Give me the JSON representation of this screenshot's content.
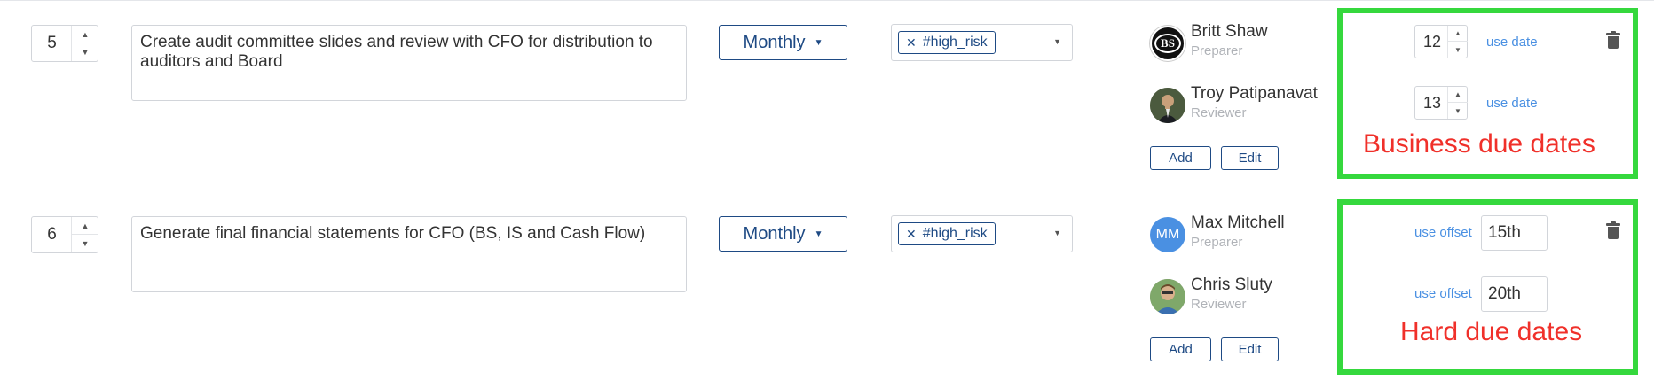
{
  "rows": [
    {
      "order": "5",
      "description": "Create audit committee slides and review with CFO for distribution to auditors and Board",
      "frequency": "Monthly",
      "tag": "#high_risk",
      "preparer": {
        "initials": "BS",
        "name": "Britt Shaw",
        "role": "Preparer"
      },
      "reviewer": {
        "name": "Troy Patipanavat",
        "role": "Reviewer"
      },
      "add_label": "Add",
      "edit_label": "Edit",
      "due": {
        "preparer_day": "12",
        "reviewer_day": "13",
        "link_label": "use date",
        "annotation": "Business due dates"
      }
    },
    {
      "order": "6",
      "description": "Generate final financial statements for CFO (BS, IS and Cash Flow)",
      "frequency": "Monthly",
      "tag": "#high_risk",
      "preparer": {
        "initials": "MM",
        "name": "Max Mitchell",
        "role": "Preparer"
      },
      "reviewer": {
        "name": "Chris Sluty",
        "role": "Reviewer"
      },
      "add_label": "Add",
      "edit_label": "Edit",
      "due": {
        "preparer_day": "15th",
        "reviewer_day": "20th",
        "link_label": "use offset",
        "annotation": "Hard due dates"
      }
    }
  ],
  "icons": {
    "spin_up": "▲",
    "spin_down": "▼",
    "caret": "▼",
    "remove": "✕"
  },
  "colors": {
    "highlight_border": "#35d83d",
    "annotation_text": "#f0302a",
    "link": "#4a90e2",
    "button": "#1e4a84"
  }
}
